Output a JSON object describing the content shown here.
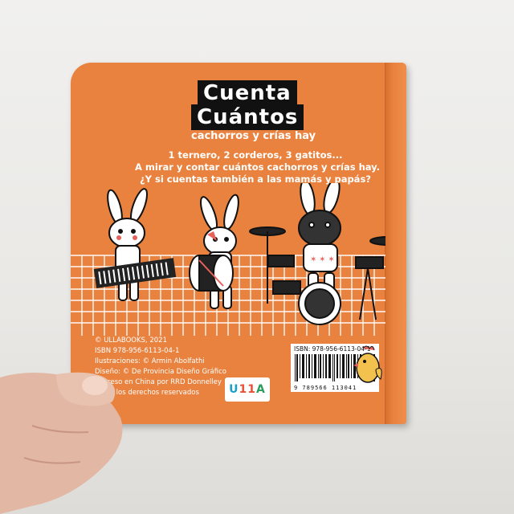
{
  "cover": {
    "title_line1": "Cuenta",
    "title_line2": "Cuántos",
    "subtitle": "cachorros y crías hay"
  },
  "blurb": [
    "1 ternero, 2 corderos, 3 gatitos...",
    "A mirar y contar cuántos cachorros y crías hay.",
    "¿Y si cuentas también a las mamás y papás?"
  ],
  "credits": [
    "© ULLABOOKS, 2021",
    "ISBN 978-956-6113-04-1",
    "Ilustraciones: © Armin Abolfathi",
    "Diseño: © De Provincia Diseño Gráfico",
    "Impreso en China por RRD Donnelley",
    "Todos los derechos reservados"
  ],
  "publisher_logo": "U11A",
  "barcode": {
    "isbn_label": "ISBN: 978-956-6113-04-1",
    "digits": "9 789566 113041"
  },
  "colors": {
    "cover_orange": "#e8823e",
    "ink": "#111111",
    "logo_u": "#1aa0c8",
    "logo_1": "#e94f37",
    "logo_a": "#2a9d5c"
  }
}
